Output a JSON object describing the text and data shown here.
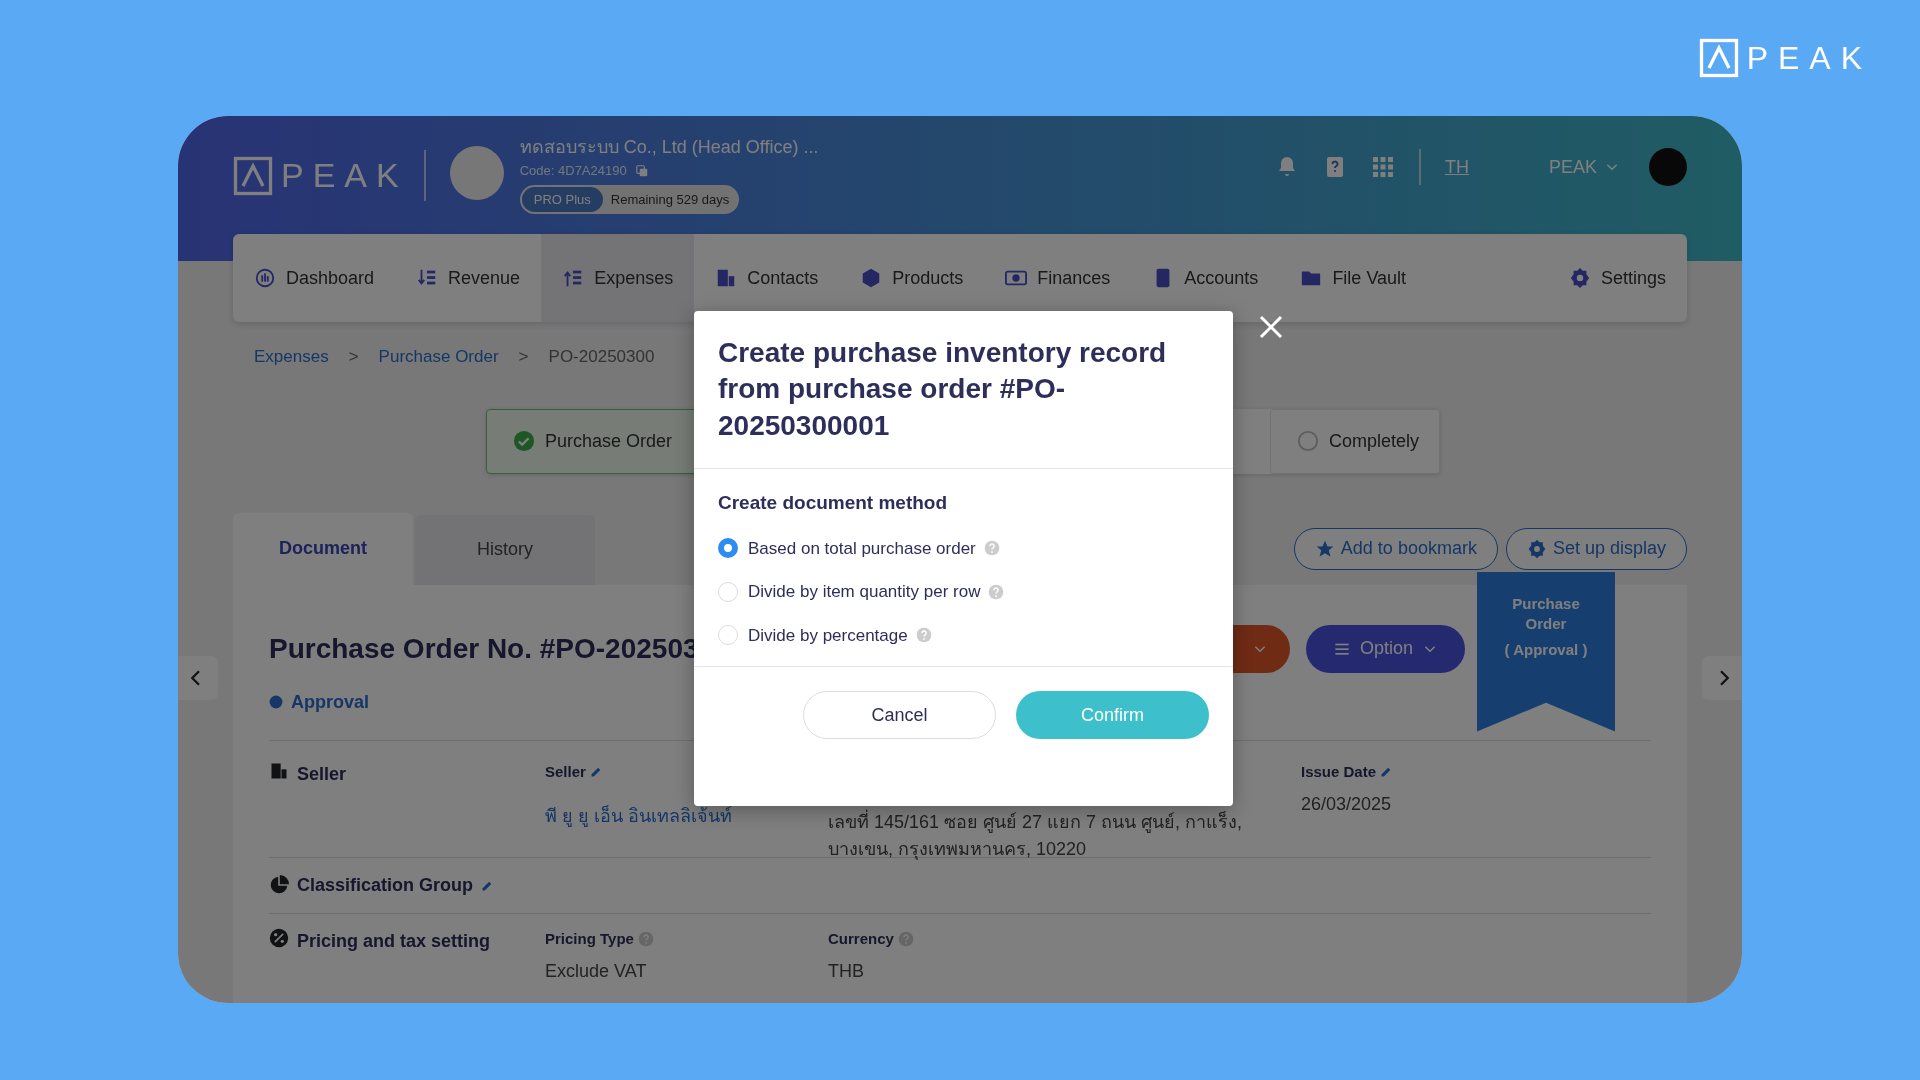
{
  "corner_logo": {
    "text": "PEAK"
  },
  "header": {
    "logo_text": "PEAK",
    "company": "ทดสอบระบบ Co., Ltd (Head Office) ...",
    "code": "Code: 4D7A24190",
    "plan": "PRO Plus",
    "remaining": "Remaining 529 days",
    "language": "TH",
    "user": "PEAK"
  },
  "nav": [
    {
      "label": "Dashboard",
      "selected": false
    },
    {
      "label": "Revenue",
      "selected": false
    },
    {
      "label": "Expenses",
      "selected": true
    },
    {
      "label": "Contacts",
      "selected": false
    },
    {
      "label": "Products",
      "selected": false
    },
    {
      "label": "Finances",
      "selected": false
    },
    {
      "label": "Accounts",
      "selected": false
    },
    {
      "label": "File Vault",
      "selected": false
    },
    {
      "label": "Settings",
      "selected": false
    }
  ],
  "breadcrumb": [
    {
      "kind": "link",
      "text": "Expenses"
    },
    {
      "kind": "separator",
      "text": ">"
    },
    {
      "kind": "link",
      "text": "Purchase Order"
    },
    {
      "kind": "separator",
      "text": ">"
    },
    {
      "kind": "current",
      "text": "PO-20250300"
    }
  ],
  "steps": [
    {
      "label": "Purchase Order",
      "done": true
    },
    {
      "label": "Completely",
      "done": false
    }
  ],
  "tabs": [
    {
      "label": "Document",
      "selected": true
    },
    {
      "label": "History",
      "selected": false
    }
  ],
  "actions": [
    "Add to bookmark",
    "Set up display"
  ],
  "document": {
    "title": "Purchase Order No. #PO-202503",
    "status": "Approval",
    "option_button": "Option",
    "ribbon": [
      "Purchase Order",
      "( Approval )"
    ],
    "seller": {
      "heading": "Seller",
      "label": "Seller",
      "name": "พี ยู ยู เอ็น อินเทลลิเจ้นท์",
      "address": [
        "เลขที่ 145/161 ซอย ศูนย์ 27 แยก 7 ถนน ศูนย์, กาแร็ง,",
        "บางเขน, กรุงเทพมหานคร, 10220"
      ],
      "date_label": "Issue Date",
      "date": "26/03/2025"
    },
    "classification": {
      "heading": "Classification Group"
    },
    "pricing": {
      "heading": "Pricing and tax setting",
      "fields": [
        {
          "label": "Pricing Type",
          "value": "Exclude VAT"
        },
        {
          "label": "Currency",
          "value": "THB"
        }
      ]
    }
  },
  "modal": {
    "title": "Create purchase inventory record from purchase order #PO-20250300001",
    "section": "Create document method",
    "options": [
      {
        "label": "Based on total purchase order",
        "selected": true
      },
      {
        "label": "Divide by item quantity per row",
        "selected": false
      },
      {
        "label": "Divide by percentage",
        "selected": false
      }
    ],
    "cancel": "Cancel",
    "confirm": "Confirm"
  }
}
